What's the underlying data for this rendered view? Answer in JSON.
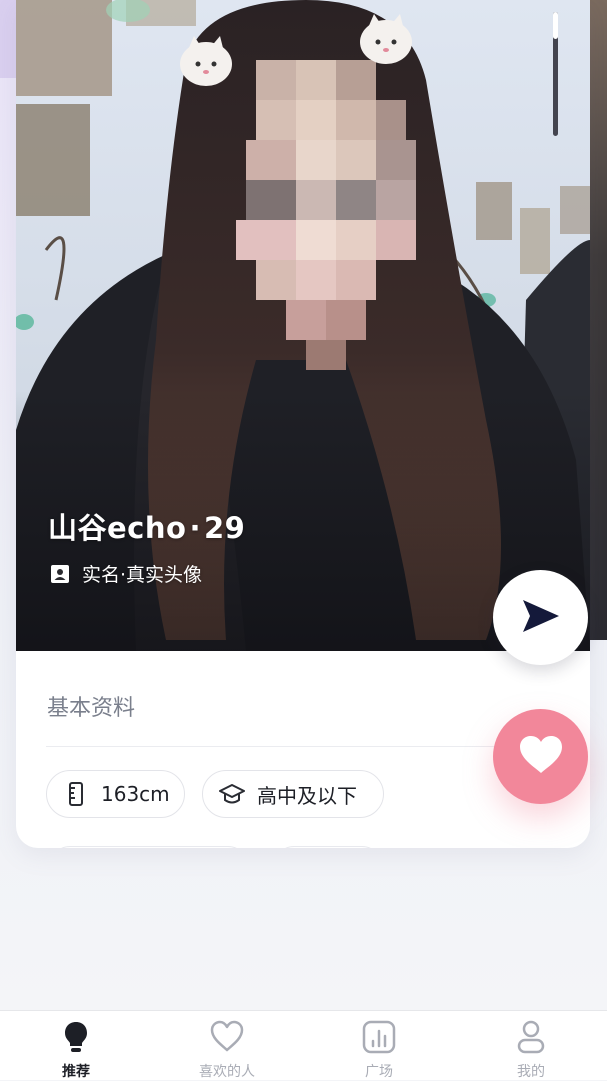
{
  "profile": {
    "name": "山谷echo",
    "separator": "·",
    "age": "29",
    "verification": "实名·真实头像"
  },
  "photo": {
    "progress": 0.22
  },
  "basic_info": {
    "title": "基本资料",
    "height": "163cm",
    "education": "高中及以下"
  },
  "actions": {
    "send_icon": "send-icon",
    "like_icon": "heart-icon"
  },
  "tabbar": {
    "items": [
      {
        "label": "推荐",
        "icon": "lightbulb-icon",
        "active": true
      },
      {
        "label": "喜欢的人",
        "icon": "heart-outline-icon",
        "active": false
      },
      {
        "label": "广场",
        "icon": "chart-icon",
        "active": false
      },
      {
        "label": "我的",
        "icon": "person-icon",
        "active": false
      }
    ]
  },
  "colors": {
    "accent_pink": "#f2879a",
    "send_icon": "#14193a",
    "active_tab": "#1d1f26",
    "inactive_tab": "#a9acb5"
  }
}
